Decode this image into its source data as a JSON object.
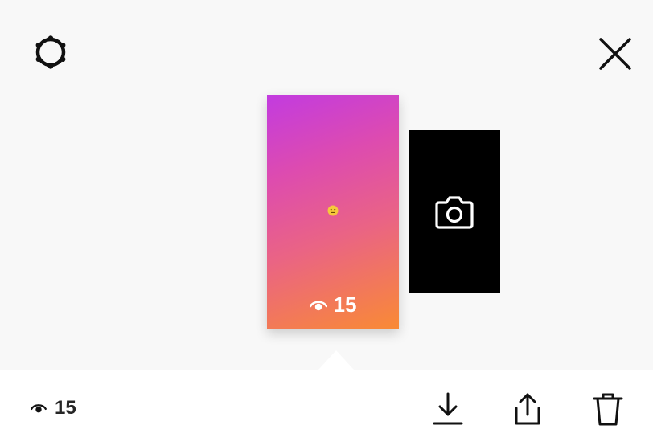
{
  "icons": {
    "settings": "gear-icon",
    "close": "close-icon",
    "camera": "camera-icon",
    "eye": "eye-icon",
    "download": "download-icon",
    "share": "share-icon",
    "delete": "trash-icon",
    "emoji": "neutral-face-emoji"
  },
  "story": {
    "views": "15"
  },
  "footer": {
    "views": "15"
  },
  "colors": {
    "gradient_start": "#c23be0",
    "gradient_end": "#f98a35",
    "icon": "#111111"
  }
}
